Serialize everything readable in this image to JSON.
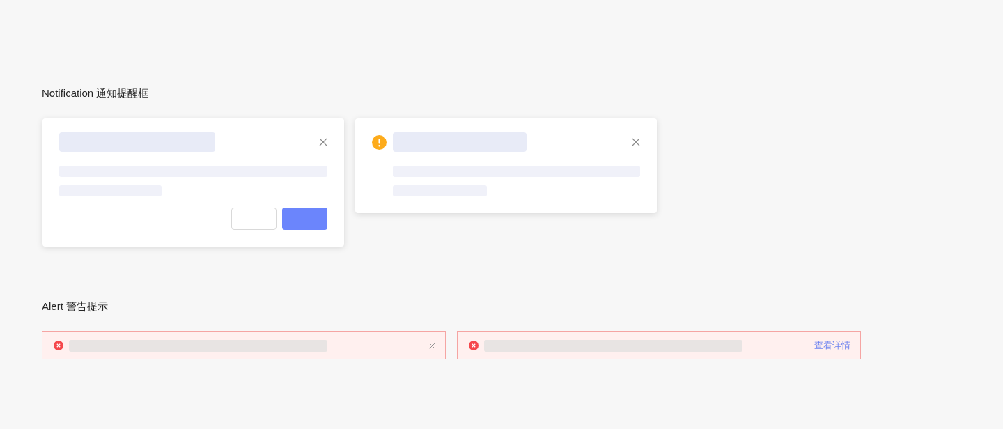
{
  "notification_section": {
    "title": "Notification 通知提醒框",
    "notifications": [
      {
        "kind": "confirm",
        "closable": true
      },
      {
        "kind": "warning",
        "closable": true
      }
    ]
  },
  "alert_section": {
    "title": "Alert 警告提示",
    "alerts": [
      {
        "kind": "error",
        "closable": true
      },
      {
        "kind": "error",
        "closable": false,
        "link": "查看详情"
      }
    ]
  }
}
